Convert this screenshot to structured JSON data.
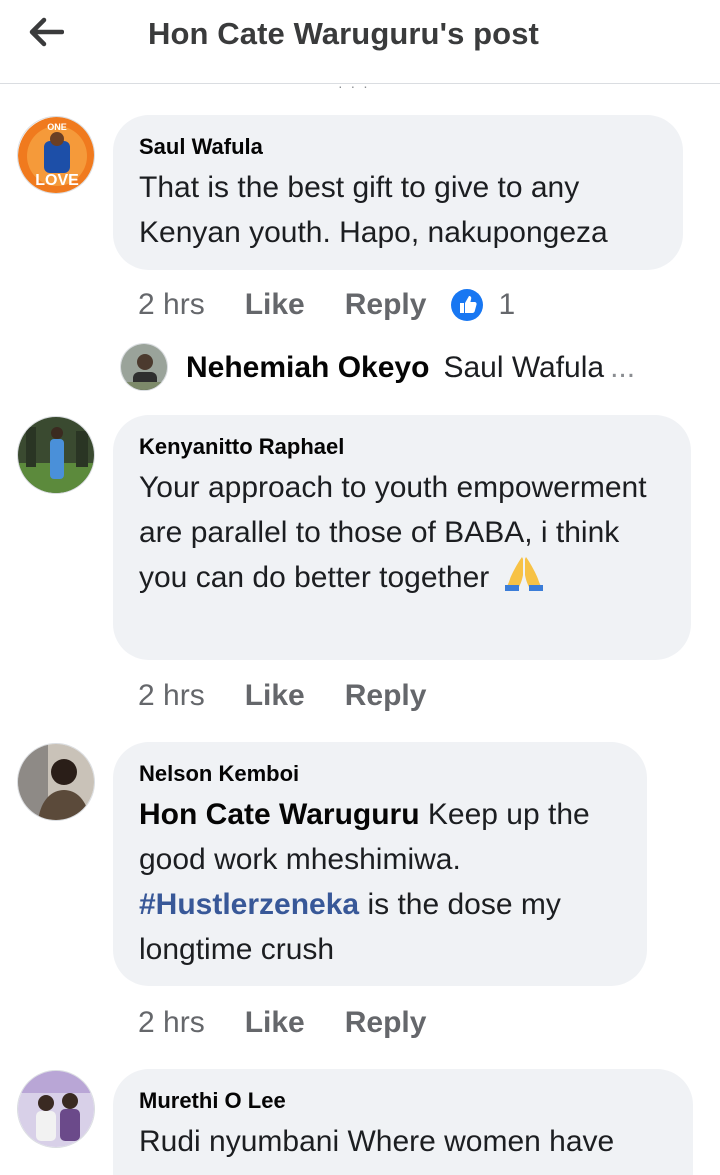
{
  "header": {
    "title": "Hon Cate Waruguru's post",
    "back_icon": "arrow-left-icon"
  },
  "comments": [
    {
      "author": "Saul Wafula",
      "text": "That is the best gift to give to any Kenyan youth. Hapo, nakupongeza",
      "time": "2 hrs",
      "like_label": "Like",
      "reply_label": "Reply",
      "reaction_icon": "thumbs-up-icon",
      "reaction_count": "1",
      "reply_preview": {
        "author": "Nehemiah Okeyo",
        "text": "Saul Wafula",
        "ellipsis": "..."
      }
    },
    {
      "author": "Kenyanitto Raphael",
      "text": "Your approach to youth empowerment are parallel to those of BABA, i think you can do better together",
      "emoji": "folded-hands-emoji",
      "time": "2 hrs",
      "like_label": "Like",
      "reply_label": "Reply"
    },
    {
      "author": "Nelson Kemboi",
      "mention": "Hon Cate Waruguru",
      "text_1": " Keep up the good work mheshimiwa. ",
      "hashtag": "#Hustlerzeneka",
      "text_2": " is the dose my longtime crush",
      "time": "2 hrs",
      "like_label": "Like",
      "reply_label": "Reply"
    },
    {
      "author": "Murethi O Lee",
      "text": "Rudi nyumbani Where women have"
    }
  ],
  "colors": {
    "bubble": "#f0f2f5",
    "hashtag": "#385898",
    "like_blue": "#1877f2",
    "meta_gray": "#65676b"
  }
}
